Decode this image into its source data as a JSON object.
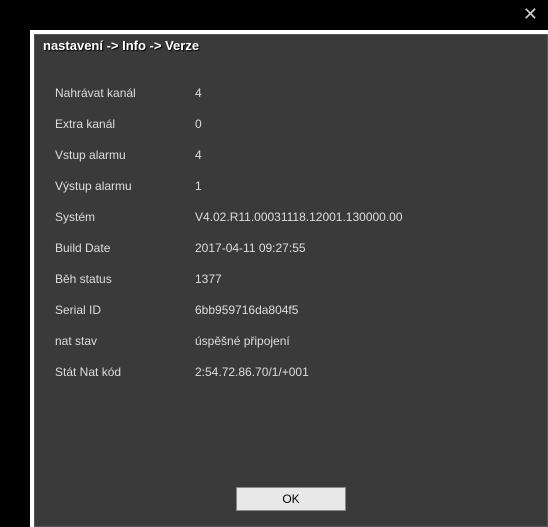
{
  "breadcrumb": "nastavení -> Info -> Verze",
  "rows": [
    {
      "label": "Nahrávat kanál",
      "value": "4"
    },
    {
      "label": "Extra kanál",
      "value": "0"
    },
    {
      "label": "Vstup alarmu",
      "value": "4"
    },
    {
      "label": "Výstup alarmu",
      "value": "1"
    },
    {
      "label": "Systém",
      "value": "V4.02.R11.00031118.12001.130000.00"
    },
    {
      "label": "Build Date",
      "value": "2017-04-11 09:27:55"
    },
    {
      "label": "Běh status",
      "value": "1377"
    },
    {
      "label": "Serial ID",
      "value": " 6bb959716da804f5"
    },
    {
      "label": "nat stav",
      "value": "úspěšné připojení"
    },
    {
      "label": "Stát Nat kód",
      "value": "2:54.72.86.70/1/+001"
    }
  ],
  "buttons": {
    "ok": "OK"
  }
}
